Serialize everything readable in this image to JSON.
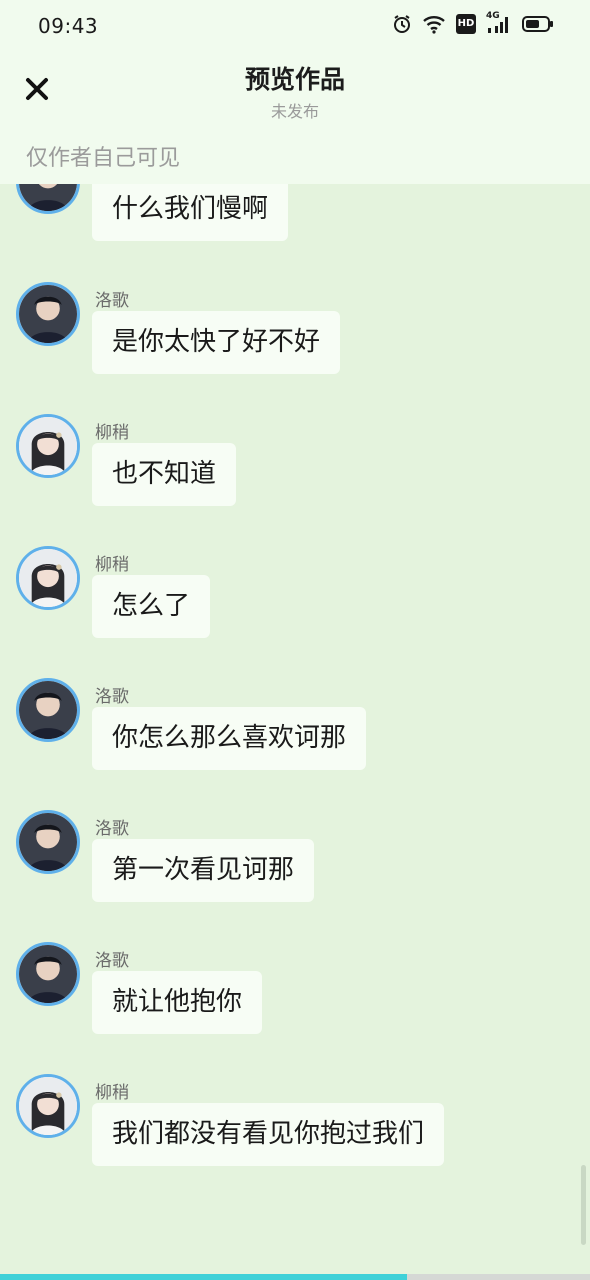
{
  "status_bar": {
    "time": "09:43",
    "icons": [
      "alarm-icon",
      "wifi-icon",
      "hd-icon",
      "signal-4g-icon",
      "battery-icon"
    ],
    "network_label": "4G",
    "hd_label": "HD"
  },
  "header": {
    "title": "预览作品",
    "subtitle": "未发布",
    "close_icon": "close-icon",
    "visibility_note": "仅作者自己可见"
  },
  "messages": [
    {
      "sender": "",
      "text": "什么我们慢啊",
      "avatar": "male"
    },
    {
      "sender": "洛歌",
      "text": "是你太快了好不好",
      "avatar": "male"
    },
    {
      "sender": "柳稍",
      "text": "也不知道",
      "avatar": "female"
    },
    {
      "sender": "柳稍",
      "text": "怎么了",
      "avatar": "female"
    },
    {
      "sender": "洛歌",
      "text": "你怎么那么喜欢诃那",
      "avatar": "male"
    },
    {
      "sender": "洛歌",
      "text": "第一次看见诃那",
      "avatar": "male"
    },
    {
      "sender": "洛歌",
      "text": "就让他抱你",
      "avatar": "male"
    },
    {
      "sender": "柳稍",
      "text": "我们都没有看见你抱过我们",
      "avatar": "female"
    }
  ],
  "playback_progress": 0.69,
  "colors": {
    "background": "#e4f3dd",
    "header_bg": "#f1fbee",
    "bubble_bg": "#f7fdf5",
    "avatar_ring": "#5fb0ea",
    "progress_fill": "#3fd1d8"
  }
}
